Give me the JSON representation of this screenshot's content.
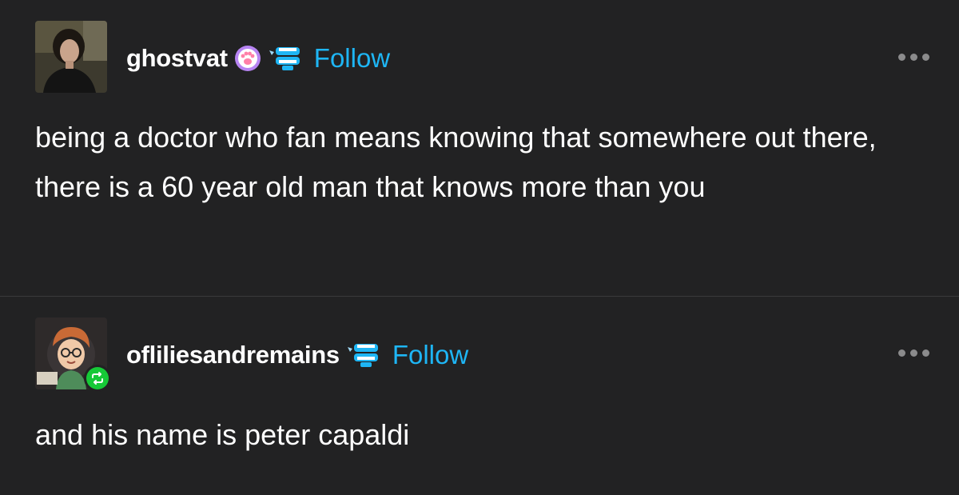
{
  "post1": {
    "username": "ghostvat",
    "follow_label": "Follow",
    "text": "being a doctor who fan means knowing that somewhere out there, there is a 60 year old man that knows more than you",
    "badges": [
      "paw-badge-icon",
      "chattering-teeth-icon"
    ]
  },
  "post2": {
    "username": "ofliliesandremains",
    "follow_label": "Follow",
    "text": "and his name is peter capaldi",
    "badges": [
      "chattering-teeth-icon",
      "reblog-icon"
    ]
  },
  "colors": {
    "background": "#222223",
    "follow": "#1eb6f5",
    "reblog": "#16c937",
    "divider": "#3a3a3b"
  }
}
